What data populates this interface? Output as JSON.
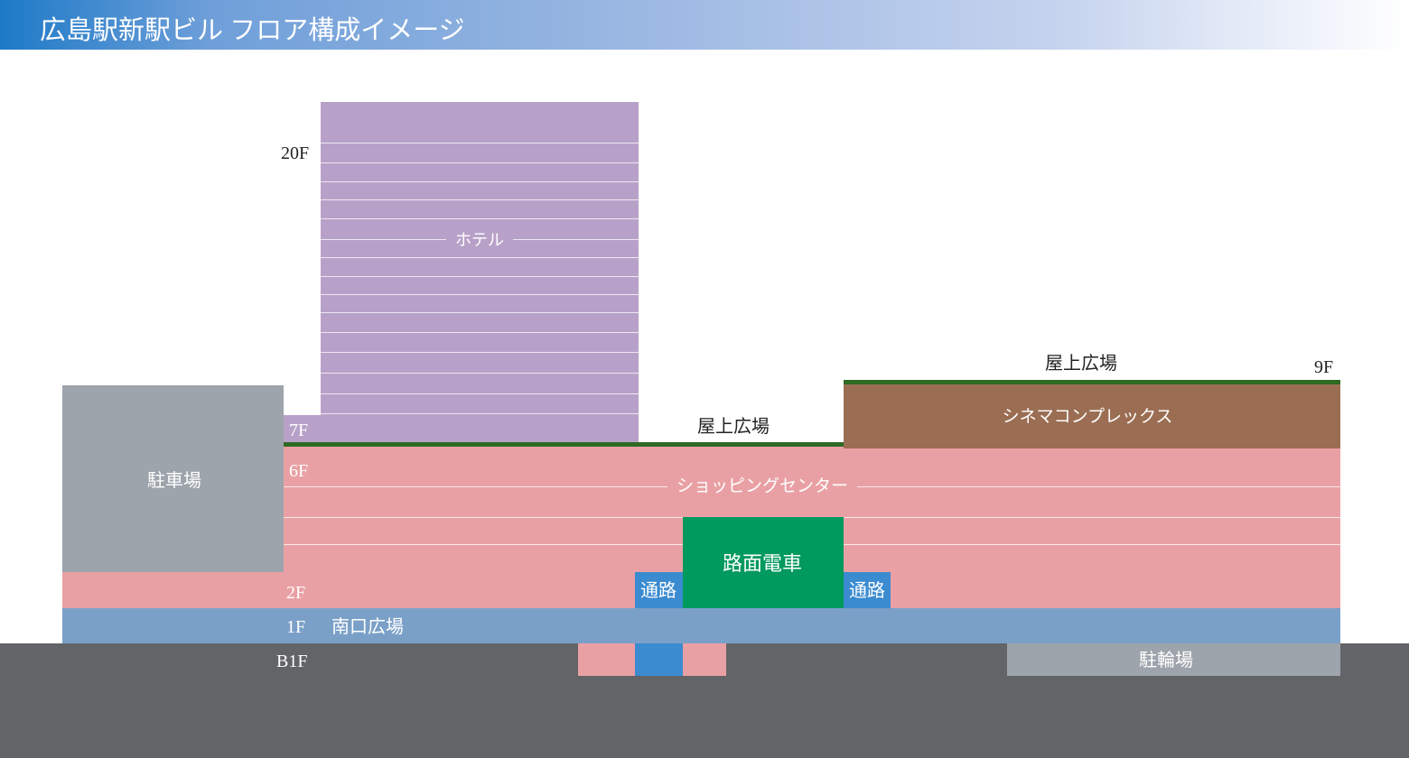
{
  "title": "広島駅新駅ビル フロア構成イメージ",
  "colors": {
    "hotel": "#b8a1c8",
    "parking": "#9ea4ac",
    "shopping": "#e9a0a4",
    "cinema": "#9b6e53",
    "tram": "#00995e",
    "passage": "#3b8bd0",
    "plaza_1f": "#7ba0c8",
    "underground": "#636467",
    "bicycle_parking": "#9ea4ac",
    "rooftop_line": "#2f6a25"
  },
  "floors": {
    "f20": "20F",
    "f9": "9F",
    "f7": "7F",
    "f6": "6F",
    "f2": "2F",
    "f1": "1F",
    "b1": "B1F"
  },
  "areas": {
    "hotel": "ホテル",
    "parking": "駐車場",
    "shopping_center": "ショッピングセンター",
    "cinema_complex": "シネマコンプレックス",
    "tram": "路面電車",
    "passage": "通路",
    "rooftop_plaza": "屋上広場",
    "south_exit_plaza": "南口広場",
    "bicycle_parking": "駐輪場"
  }
}
